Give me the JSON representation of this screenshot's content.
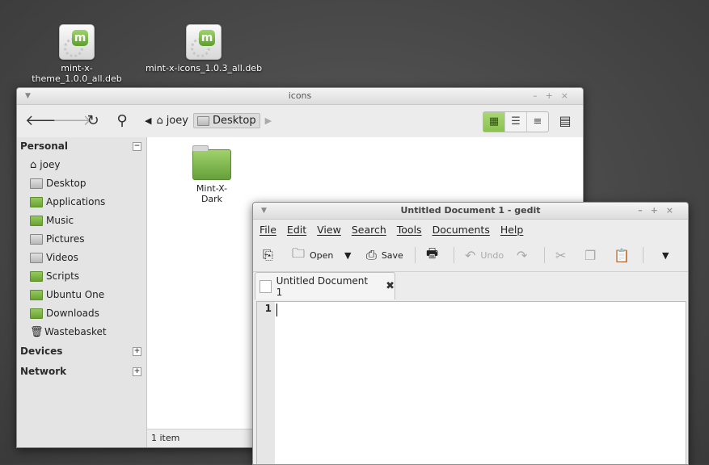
{
  "desktop": {
    "icons": [
      {
        "label": "mint-x-theme_1.0.0_all.deb"
      },
      {
        "label": "mint-x-icons_1.0.3_all.deb"
      }
    ]
  },
  "nemo": {
    "title": "icons",
    "crumbs": [
      "joey",
      "Desktop"
    ],
    "sidebar": {
      "personal": "Personal",
      "items": [
        "joey",
        "Desktop",
        "Applications",
        "Music",
        "Pictures",
        "Videos",
        "Scripts",
        "Ubuntu One",
        "Downloads",
        "Wastebasket"
      ],
      "devices": "Devices",
      "network": "Network"
    },
    "folder": "Mint-X-Dark",
    "status": "1 item"
  },
  "gedit": {
    "title": "Untitled Document 1 - gedit",
    "menu": [
      "File",
      "Edit",
      "View",
      "Search",
      "Tools",
      "Documents",
      "Help"
    ],
    "toolbar": {
      "open": "Open",
      "save": "Save",
      "undo": "Undo"
    },
    "tab": "Untitled Document 1",
    "line": "1"
  }
}
